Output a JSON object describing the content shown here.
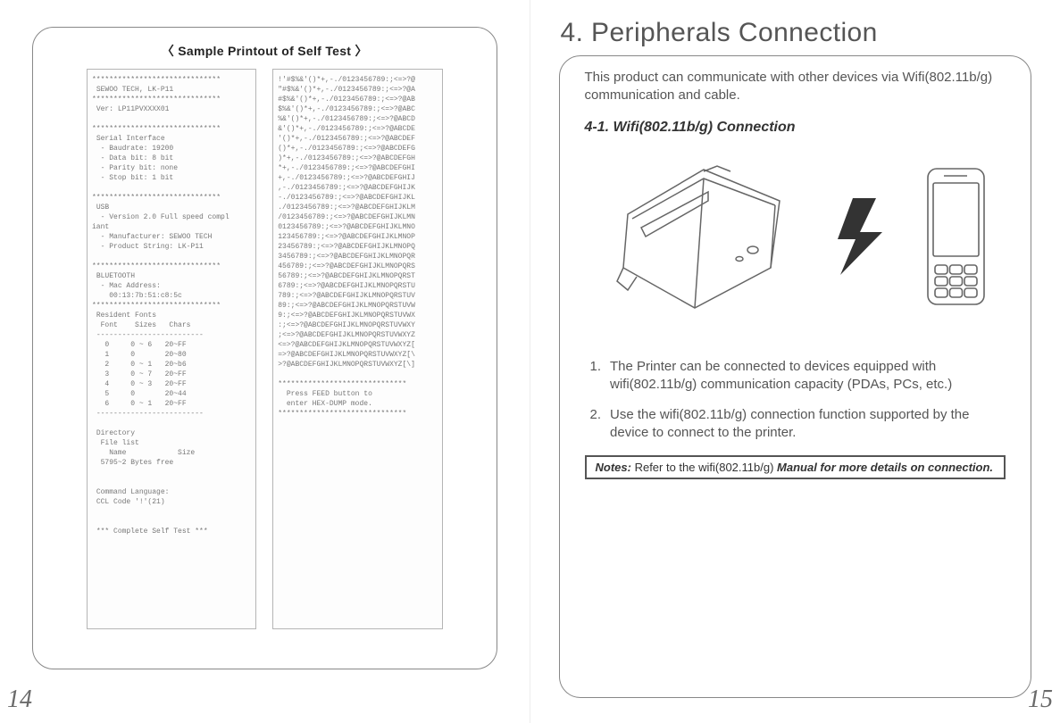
{
  "left": {
    "caption": "〈 Sample Printout of Self Test 〉",
    "col1_text": "******************************\n SEWOO TECH, LK-P11\n******************************\n Ver: LP11PVXXXX01\n\n******************************\n Serial Interface\n  - Baudrate: 19200\n  - Data bit: 8 bit\n  - Parity bit: none\n  - Stop bit: 1 bit\n\n******************************\n USB\n  - Version 2.0 Full speed compl\niant\n  - Manufacturer: SEWOO TECH\n  - Product String: LK-P11\n\n******************************\n BLUETOOTH\n  - Mac Address:\n    00:13:7b:51:c8:5c\n******************************\n Resident Fonts\n  Font    Sizes   Chars\n -------------------------\n   0     0 ~ 6   20~FF\n   1     0       20~80\n   2     0 ~ 1   20~b6\n   3     0 ~ 7   20~FF\n   4     0 ~ 3   20~FF\n   5     0       20~44\n   6     0 ~ 1   20~FF\n -------------------------\n\n Directory\n  File list\n    Name            Size\n  5795~2 Bytes free\n\n\n Command Language:\n CCL Code '!'(21)\n\n\n *** Complete Self Test ***",
    "col2_text": "!'#$%&'()*+,-./0123456789:;<=>?@\n\"#$%&'()*+,-./0123456789:;<=>?@A\n#$%&'()*+,-./0123456789:;<=>?@AB\n$%&'()*+,-./0123456789:;<=>?@ABC\n%&'()*+,-./0123456789:;<=>?@ABCD\n&'()*+,-./0123456789:;<=>?@ABCDE\n'()*+,-./0123456789:;<=>?@ABCDEF\n()*+,-./0123456789:;<=>?@ABCDEFG\n)*+,-./0123456789:;<=>?@ABCDEFGH\n*+,-./0123456789:;<=>?@ABCDEFGHI\n+,-./0123456789:;<=>?@ABCDEFGHIJ\n,-./0123456789:;<=>?@ABCDEFGHIJK\n-./0123456789:;<=>?@ABCDEFGHIJKL\n./0123456789:;<=>?@ABCDEFGHIJKLM\n/0123456789:;<=>?@ABCDEFGHIJKLMN\n0123456789:;<=>?@ABCDEFGHIJKLMNO\n123456789:;<=>?@ABCDEFGHIJKLMNOP\n23456789:;<=>?@ABCDEFGHIJKLMNOPQ\n3456789:;<=>?@ABCDEFGHIJKLMNOPQR\n456789:;<=>?@ABCDEFGHIJKLMNOPQRS\n56789:;<=>?@ABCDEFGHIJKLMNOPQRST\n6789:;<=>?@ABCDEFGHIJKLMNOPQRSTU\n789:;<=>?@ABCDEFGHIJKLMNOPQRSTUV\n89:;<=>?@ABCDEFGHIJKLMNOPQRSTUVW\n9:;<=>?@ABCDEFGHIJKLMNOPQRSTUVWX\n:;<=>?@ABCDEFGHIJKLMNOPQRSTUVWXY\n;<=>?@ABCDEFGHIJKLMNOPQRSTUVWXYZ\n<=>?@ABCDEFGHIJKLMNOPQRSTUVWXYZ[\n=>?@ABCDEFGHIJKLMNOPQRSTUVWXYZ[\\\n>?@ABCDEFGHIJKLMNOPQRSTUVWXYZ[\\]\n\n******************************\n  Press FEED button to\n  enter HEX-DUMP mode.\n******************************",
    "page_number": "14"
  },
  "right": {
    "heading": "4. Peripherals Connection",
    "intro": "This product can communicate with other devices via Wifi(802.11b/g) communication and cable.",
    "subhead": "4-1. Wifi(802.11b/g) Connection",
    "step1_num": "1.",
    "step1_text": "The Printer can be connected to devices equipped with wifi(802.11b/g) communication capacity (PDAs, PCs, etc.)",
    "step2_num": "2.",
    "step2_text": "Use the wifi(802.11b/g) connection function supported by the device to connect to the printer.",
    "notes_label": "Notes:",
    "notes_mid": "Refer to the wifi(802.11b/g) ",
    "notes_rest": "Manual for more details on connection.",
    "page_number": "15"
  }
}
